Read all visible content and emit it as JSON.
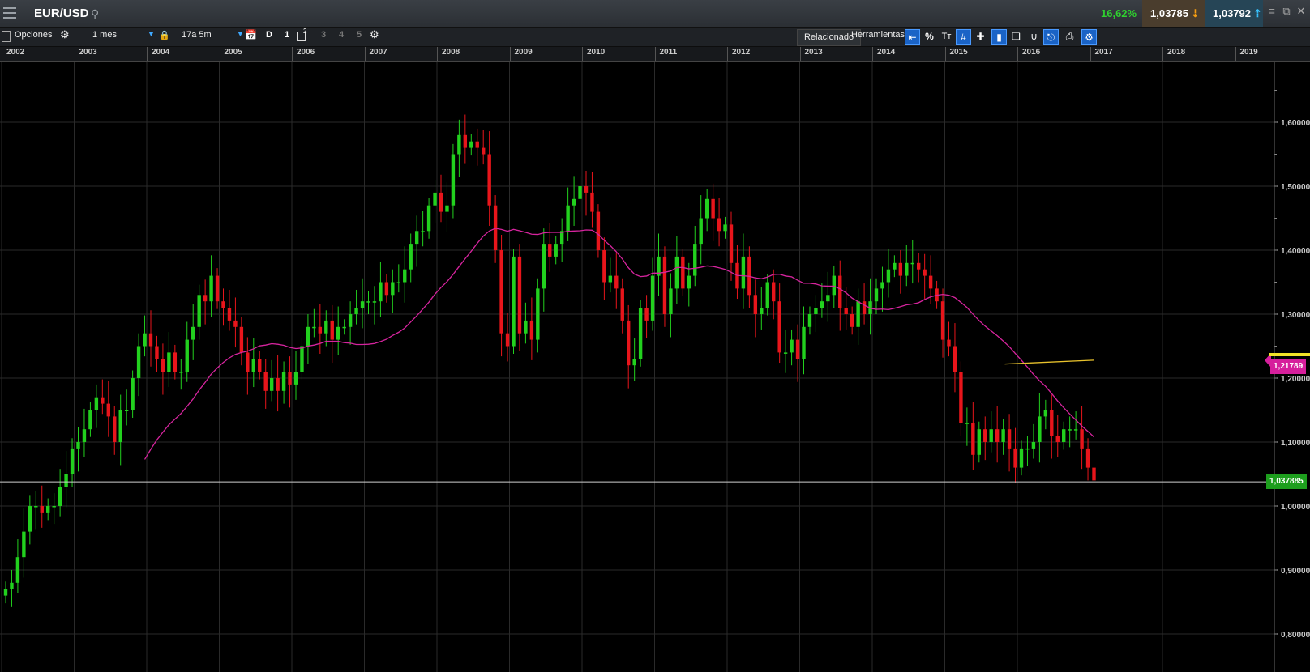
{
  "header": {
    "symbol": "EUR/USD",
    "change_pct": "16,62%",
    "sell_price": "1,03785",
    "buy_price": "1,03792"
  },
  "toolbar": {
    "options_label": "Opciones",
    "interval_value": "1 mes",
    "range_value": "17a 5m",
    "d_label": "D",
    "numbers": [
      "1",
      "3",
      "4",
      "5"
    ],
    "superscript": "2",
    "related_label": "Relacionado",
    "tools_label": "Herramientas",
    "percent_label": "%",
    "text_label": "Tт"
  },
  "chart_data": {
    "type": "candlestick",
    "symbol": "EUR/USD",
    "interval": "1 mes",
    "x_axis_years": [
      "2002",
      "2003",
      "2004",
      "2005",
      "2006",
      "2007",
      "2008",
      "2009",
      "2010",
      "2011",
      "2012",
      "2013",
      "2014",
      "2015",
      "2016",
      "2017",
      "2018",
      "2019"
    ],
    "y_tick_labels": [
      "1,60000",
      "1,50000",
      "1,40000",
      "1,30000",
      "1,20000",
      "1,10000",
      "1,00000",
      "0,90000",
      "0,80000"
    ],
    "y_range": [
      0.77,
      1.7
    ],
    "grid": true,
    "current_price_label": "1,037885",
    "current_price": 1.037885,
    "moving_average_label": "1,21789",
    "moving_average_value": 1.21789,
    "candles_close": [
      0.87,
      0.88,
      0.92,
      0.96,
      1.0,
      1.0,
      0.99,
      1.0,
      1.0,
      1.03,
      1.05,
      1.09,
      1.1,
      1.12,
      1.15,
      1.17,
      1.16,
      1.14,
      1.1,
      1.15,
      1.15,
      1.2,
      1.25,
      1.27,
      1.25,
      1.23,
      1.21,
      1.24,
      1.21,
      1.21,
      1.26,
      1.28,
      1.33,
      1.32,
      1.36,
      1.32,
      1.31,
      1.29,
      1.28,
      1.24,
      1.21,
      1.23,
      1.21,
      1.18,
      1.2,
      1.18,
      1.21,
      1.19,
      1.21,
      1.25,
      1.28,
      1.28,
      1.27,
      1.29,
      1.26,
      1.28,
      1.28,
      1.3,
      1.31,
      1.32,
      1.32,
      1.32,
      1.35,
      1.33,
      1.35,
      1.35,
      1.37,
      1.41,
      1.43,
      1.43,
      1.47,
      1.49,
      1.46,
      1.47,
      1.55,
      1.58,
      1.56,
      1.57,
      1.56,
      1.55,
      1.47,
      1.4,
      1.27,
      1.25,
      1.39,
      1.27,
      1.29,
      1.26,
      1.34,
      1.41,
      1.39,
      1.41,
      1.43,
      1.47,
      1.48,
      1.5,
      1.49,
      1.46,
      1.4,
      1.35,
      1.36,
      1.34,
      1.29,
      1.22,
      1.23,
      1.31,
      1.29,
      1.36,
      1.39,
      1.3,
      1.34,
      1.39,
      1.34,
      1.36,
      1.41,
      1.45,
      1.48,
      1.45,
      1.43,
      1.44,
      1.38,
      1.34,
      1.39,
      1.33,
      1.3,
      1.31,
      1.35,
      1.32,
      1.24,
      1.24,
      1.26,
      1.23,
      1.28,
      1.3,
      1.31,
      1.32,
      1.33,
      1.36,
      1.31,
      1.3,
      1.28,
      1.32,
      1.3,
      1.32,
      1.34,
      1.35,
      1.37,
      1.38,
      1.36,
      1.38,
      1.38,
      1.37,
      1.36,
      1.34,
      1.32,
      1.26,
      1.25,
      1.21,
      1.13,
      1.13,
      1.08,
      1.12,
      1.1,
      1.12,
      1.1,
      1.12,
      1.09,
      1.06,
      1.09,
      1.09,
      1.1,
      1.14,
      1.15,
      1.11,
      1.1,
      1.12,
      1.12,
      1.12,
      1.09,
      1.06,
      1.04
    ],
    "ma_path_years": [
      "2002",
      "2017"
    ],
    "lines": [
      "Media móvil",
      "Línea de tendencia"
    ]
  },
  "colors": {
    "up_candle": "#22d11e",
    "down_candle": "#e8151b",
    "moving_average": "#d6249e",
    "trendline": "#e8c22c",
    "grid": "#2a2a2a",
    "current_price_bg": "#1d9e1d",
    "ma_tag_bg": "#d61f9c"
  }
}
